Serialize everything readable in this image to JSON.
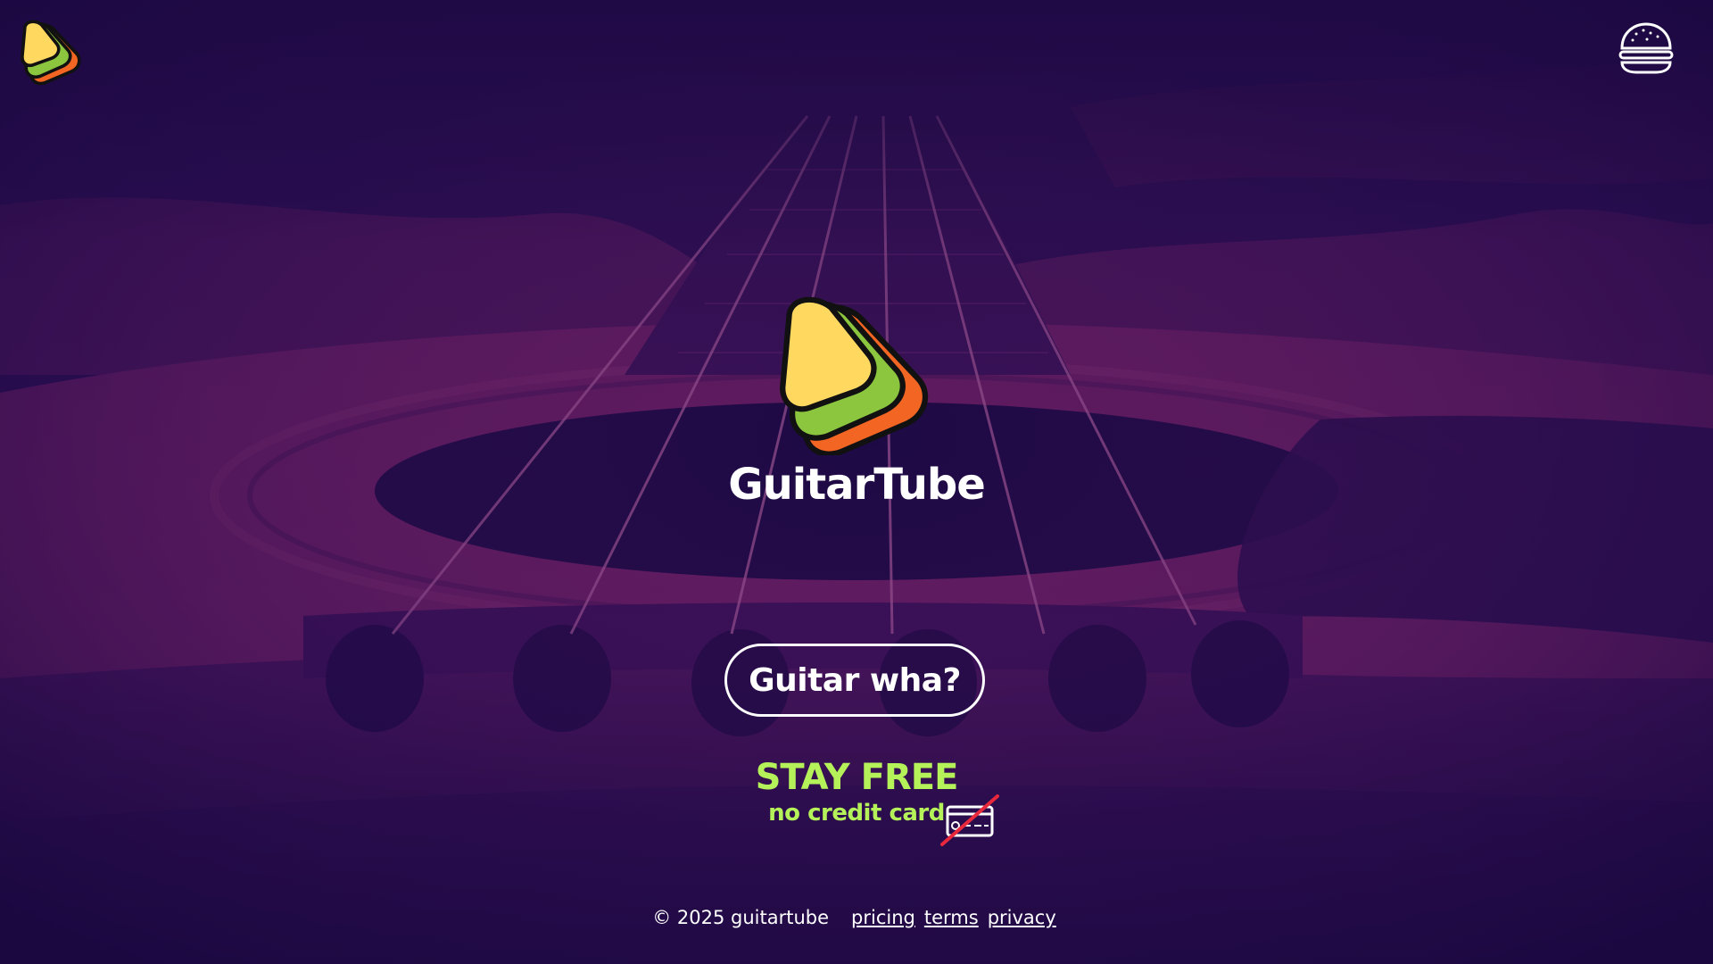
{
  "brand": {
    "name": "GuitarTube"
  },
  "header": {
    "logo_icon": "guitartube-logo-icon",
    "menu_icon": "burger-menu-icon"
  },
  "hero": {
    "cta_label": "Guitar wha?",
    "stay_free": "STAY FREE",
    "no_credit_card": "no credit card",
    "card_icon": "no-credit-card-icon"
  },
  "footer": {
    "copyright": "©  2025 guitartube",
    "links": {
      "pricing": "pricing",
      "terms": "terms",
      "privacy": "privacy"
    }
  },
  "colors": {
    "background": "#1d0a45",
    "accent_green": "#b5f25a",
    "logo_yellow": "#ffd95f",
    "logo_green": "#8cc63e",
    "logo_orange": "#f26522",
    "text": "#ffffff"
  }
}
